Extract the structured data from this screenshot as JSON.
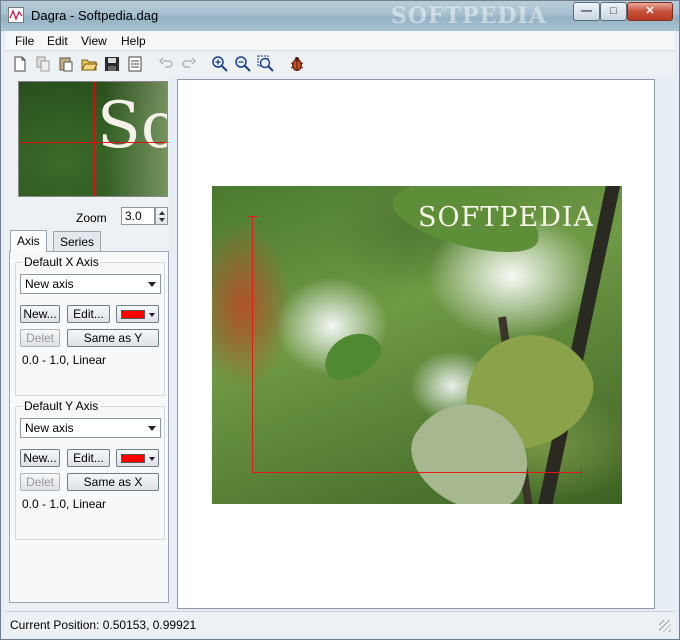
{
  "window": {
    "title": "Dagra - Softpedia.dag",
    "title_watermark": "SOFTPEDIA",
    "buttons": {
      "minimize": "—",
      "maximize": "□",
      "close": "✕"
    }
  },
  "menu": [
    {
      "label": "File"
    },
    {
      "label": "Edit"
    },
    {
      "label": "View"
    },
    {
      "label": "Help"
    }
  ],
  "toolbar": {
    "icons": [
      "new-icon",
      "copy-icon",
      "paste-icon",
      "open-icon",
      "save-icon",
      "properties-icon",
      "undo-icon",
      "redo-icon",
      "zoom-in-icon",
      "zoom-out-icon",
      "zoom-fit-icon",
      "bug-icon"
    ]
  },
  "preview": {
    "text": "So"
  },
  "zoom": {
    "label": "Zoom",
    "value": "3.0"
  },
  "tabs": [
    {
      "label": "Axis",
      "active": true
    },
    {
      "label": "Series",
      "active": false
    }
  ],
  "x_axis": {
    "group_title": "Default X Axis",
    "select_value": "New axis",
    "new_label": "New...",
    "edit_label": "Edit...",
    "delete_label": "Delet",
    "same_label": "Same as Y",
    "range_text": "0.0 - 1.0, Linear",
    "color": "#ff0000"
  },
  "y_axis": {
    "group_title": "Default Y Axis",
    "select_value": "New axis",
    "new_label": "New...",
    "edit_label": "Edit...",
    "delete_label": "Delet",
    "same_label": "Same as X",
    "range_text": "0.0 - 1.0, Linear",
    "color": "#ff0000"
  },
  "canvas": {
    "watermark": "SOFTPEDIA",
    "axis_color": "#e21a1a"
  },
  "status": {
    "text": "Current Position: 0.50153, 0.99921"
  }
}
